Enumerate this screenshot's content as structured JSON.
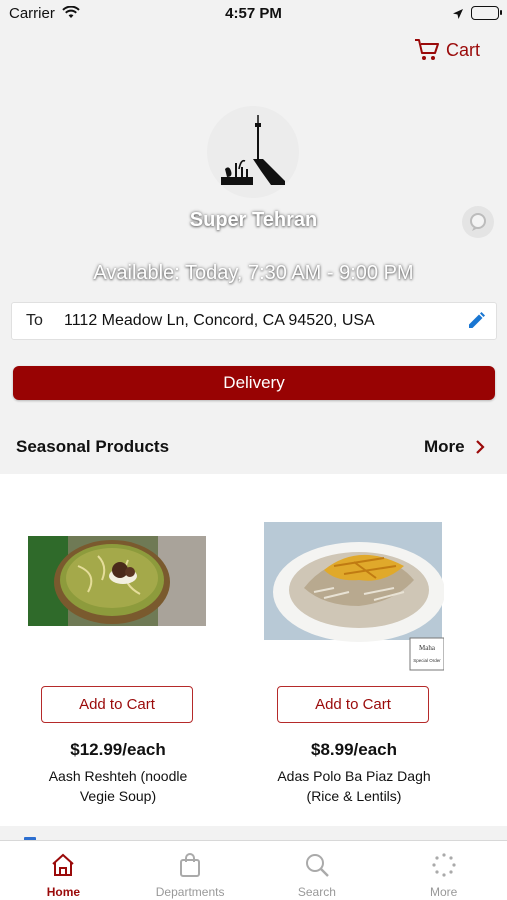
{
  "status_bar": {
    "carrier": "Carrier",
    "time": "4:57 PM"
  },
  "header": {
    "cart_label": "Cart",
    "store_name": "Super Tehran",
    "availability": "Available: Today, 7:30 AM - 9:00 PM"
  },
  "address": {
    "prefix": "To",
    "value": "1112 Meadow Ln, Concord, CA 94520, USA"
  },
  "delivery_button": "Delivery",
  "section": {
    "title": "Seasonal Products",
    "more_label": "More"
  },
  "products": [
    {
      "add_label": "Add to Cart",
      "price": "$12.99/each",
      "name": "Aash Reshteh (noodle Vegie Soup)"
    },
    {
      "add_label": "Add to Cart",
      "price": "$8.99/each",
      "name": "Adas Polo Ba Piaz Dagh (Rice & Lentils)",
      "badge": "Maha Special Order"
    }
  ],
  "tabs": [
    {
      "label": "Home",
      "icon": "home-icon",
      "active": true
    },
    {
      "label": "Departments",
      "icon": "shopping-bag-icon",
      "active": false
    },
    {
      "label": "Search",
      "icon": "search-icon",
      "active": false
    },
    {
      "label": "More",
      "icon": "more-dots-icon",
      "active": false
    }
  ],
  "colors": {
    "brand": "#980303",
    "accent_text": "#9a0a0a",
    "edit_icon": "#1976d2"
  }
}
